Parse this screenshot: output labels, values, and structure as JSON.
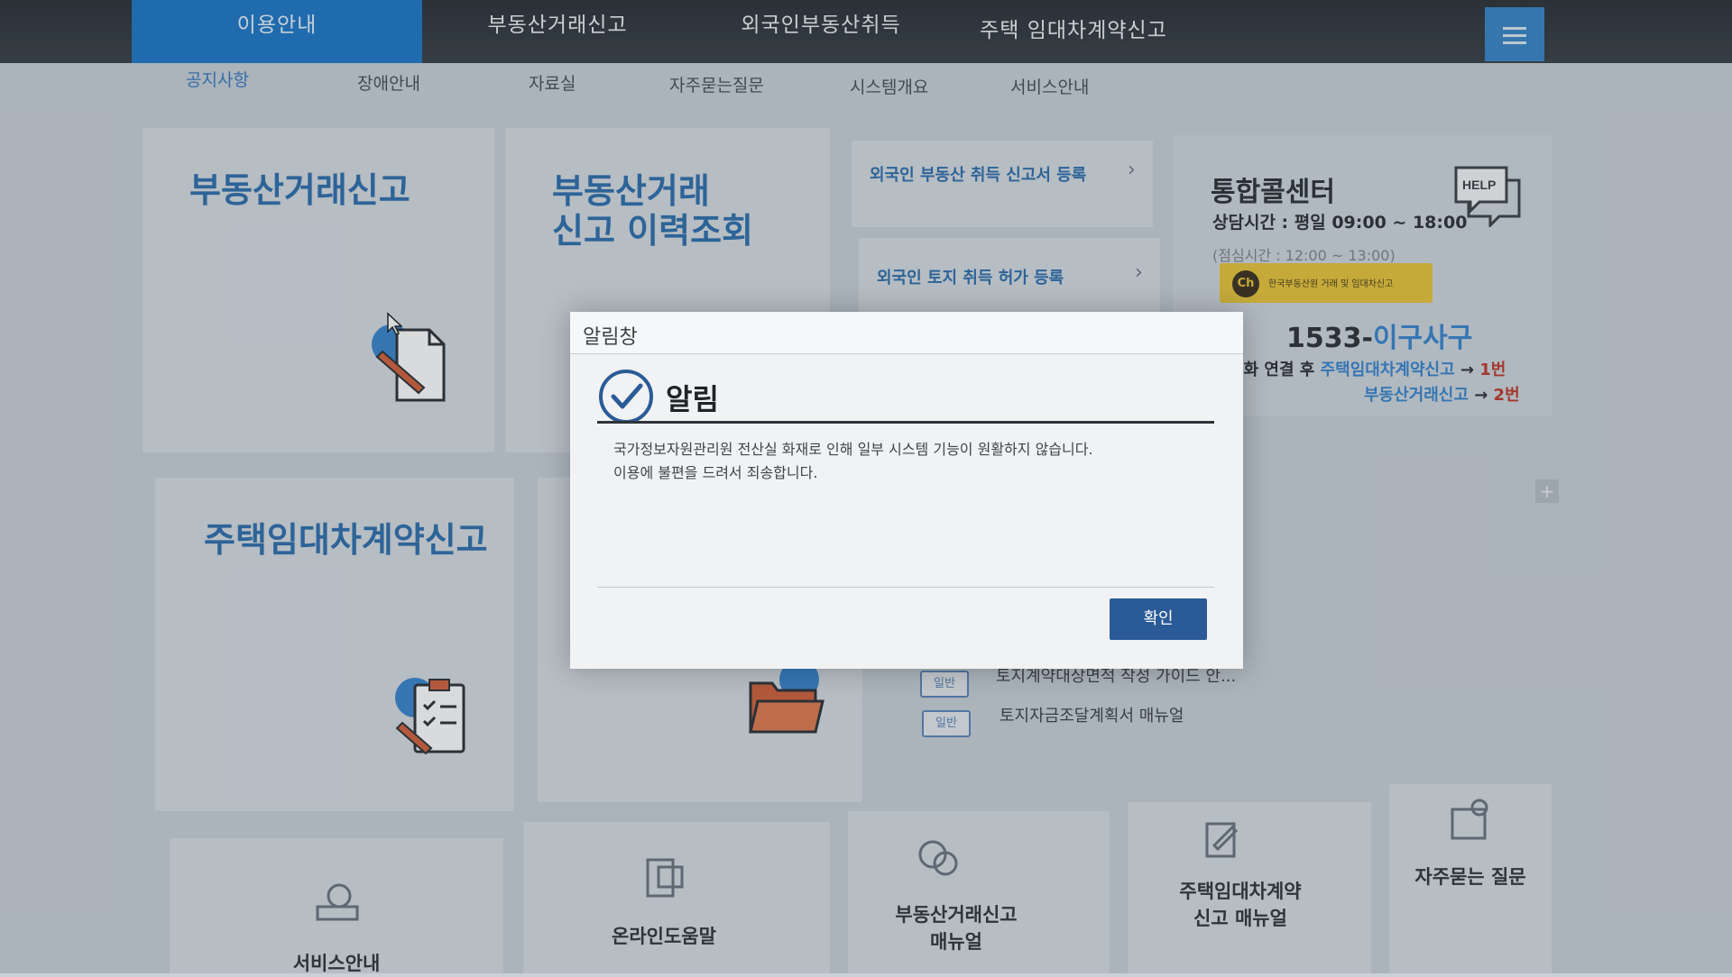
{
  "topnav": {
    "tabs": [
      {
        "label": "이용안내",
        "active": true
      },
      {
        "label": "부동산거래신고",
        "active": false
      },
      {
        "label": "외국인부동산취득",
        "active": false
      },
      {
        "label": "주택 임대차계약신고",
        "active": false
      }
    ]
  },
  "subnav": {
    "items": [
      "공지사항",
      "장애안내",
      "자료실",
      "자주묻는질문",
      "시스템개요",
      "서비스안내"
    ]
  },
  "cards": {
    "real_estate_report": "부동산거래신고",
    "history_line1": "부동산거래",
    "history_line2": "신고 이력조회",
    "lease_report": "주택임대차계약신고"
  },
  "side_links": {
    "foreign_acquire": "외국인 부동산 취득 신고서 등록",
    "foreign_land": "외국인 토지 취득 허가 등록"
  },
  "call_center": {
    "title": "통합콜센터",
    "help": "HELP",
    "hours": "상담시간 : 평일 09:00 ~ 18:00",
    "lunch": "(점심시간 : 12:00 ~ 13:00)",
    "kakao_ch": "Ch",
    "kakao_text": "한국부동산원 거래 및 임대차신고",
    "phone_prefix": "1533-",
    "phone_hl": "이구사구",
    "route1_pre": "전화 연결 후 ",
    "route1_hl": "주택임대차계약신고",
    "route1_arrow": " → ",
    "route1_num": "1번",
    "route2_text": "부동산거래신고",
    "route2_arrow": " → ",
    "route2_num": "2번",
    "plus": "+"
  },
  "notices": [
    {
      "badge": "일반",
      "title": "토지계약대상면적 작성 가이드 안..."
    },
    {
      "badge": "일반",
      "title": "토지자금조달계획서 매뉴얼"
    }
  ],
  "bottom": {
    "service": "서비스안내",
    "online_help": "온라인도움말",
    "manual_line1": "부동산거래신고",
    "manual_line2": "매뉴얼",
    "lease_manual_line1": "주택임대차계약",
    "lease_manual_line2": "신고 매뉴얼",
    "faq": "자주묻는 질문"
  },
  "modal": {
    "window_title": "알림창",
    "title": "알림",
    "message_line1": "국가정보자원관리원 전산실 화재로 인해 일부 시스템 기능이 원활하지 않습니다.",
    "message_line2": "이용에 불편을 드려서 죄송합니다.",
    "ok_label": "확인"
  },
  "colors": {
    "accent": "#1f78c8",
    "brand_text": "#2f6fae",
    "modal_button": "#2a5b97"
  }
}
